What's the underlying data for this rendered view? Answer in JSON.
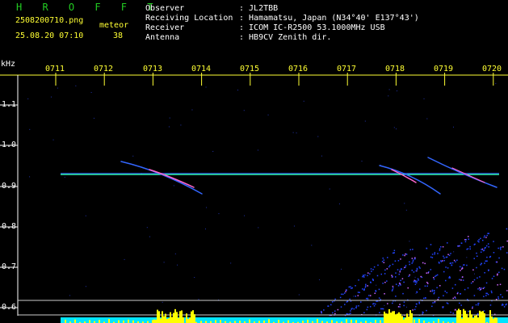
{
  "header": {
    "title": "H R O F F T",
    "filename": "2508200710.png",
    "datetime": "25.08.20 07:10",
    "count_label": "meteor",
    "count_value": "38",
    "info_labels": [
      "Observer",
      "Receiving Location",
      "Receiver",
      "Antenna"
    ],
    "info_values": [
      ": JL2TBB",
      ": Hamamatsu, Japan (N34°40' E137°43')",
      ": ICOM IC-R2500 53.1000MHz USB",
      ": HB9CV Zenith dir."
    ]
  },
  "axes": {
    "y_unit": "kHz",
    "y_ticks": [
      "1.1",
      "1.0",
      "0.9",
      "0.8",
      "0.7",
      "0.6"
    ],
    "x_ticks": [
      "0711",
      "0712",
      "0713",
      "0714",
      "0715",
      "0716",
      "0717",
      "0718",
      "0719",
      "0720"
    ]
  },
  "colors": {
    "background": "#000000",
    "header_title": "#22cc22",
    "header_text": "#ffff33",
    "info_text": "#ffffff",
    "carrier_line": "#33ffcc",
    "signal_floor": "#00e5ff",
    "signal_peaks": "#ffff00"
  }
}
